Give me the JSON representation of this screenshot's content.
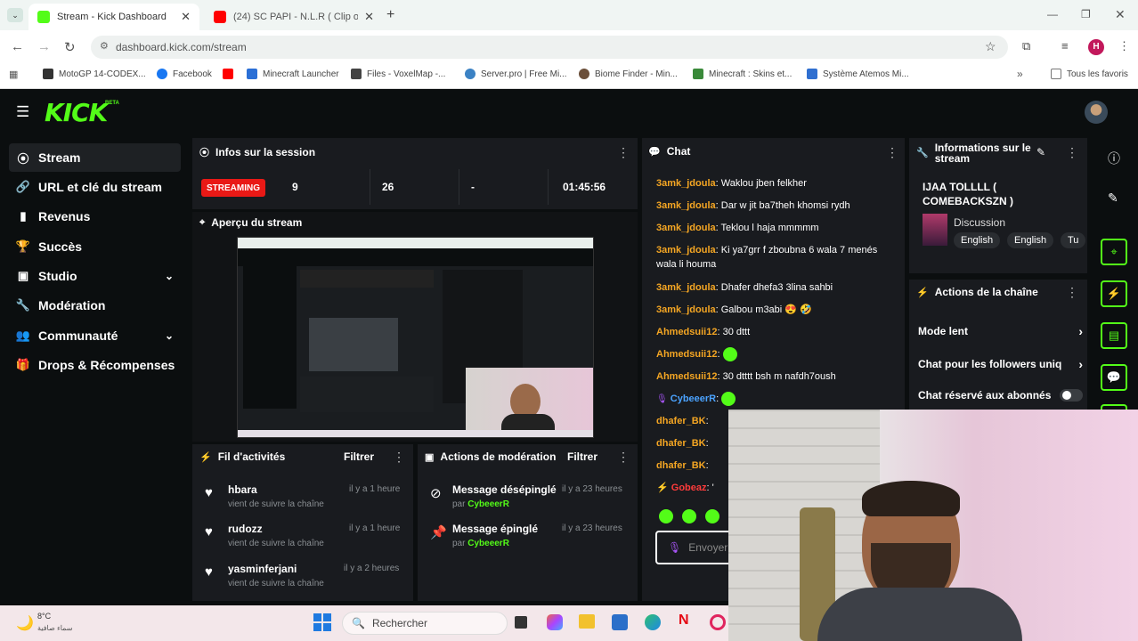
{
  "browser": {
    "tabs": [
      {
        "title": "Stream - Kick Dashboard",
        "active": true,
        "favicon_color": "#53fc18"
      },
      {
        "title": "(24) SC PAPI - N.L.R ( Clip offici",
        "active": false,
        "favicon_color": "#ff0000"
      }
    ],
    "url": "dashboard.kick.com/stream",
    "profile_initial": "H",
    "bookmarks": [
      "MotoGP 14-CODEX...",
      "Facebook",
      "",
      "Minecraft Launcher",
      "Files - VoxelMap -...",
      "Server.pro | Free Mi...",
      "Biome Finder - Min...",
      "Minecraft : Skins et...",
      "Système Atemos Mi..."
    ],
    "all_bookmarks": "Tous les favoris"
  },
  "kick": {
    "logo": "KICK",
    "beta": "BETA"
  },
  "sidebar": {
    "items": [
      {
        "label": "Stream",
        "icon": "broadcast-icon",
        "active": true
      },
      {
        "label": "URL et clé du stream",
        "icon": "link-icon"
      },
      {
        "label": "Revenus",
        "icon": "chart-icon"
      },
      {
        "label": "Succès",
        "icon": "trophy-icon"
      },
      {
        "label": "Studio",
        "icon": "studio-icon",
        "chevron": true
      },
      {
        "label": "Modération",
        "icon": "wrench-icon"
      },
      {
        "label": "Communauté",
        "icon": "people-icon",
        "chevron": true
      },
      {
        "label": "Drops & Récompenses",
        "icon": "gift-icon"
      }
    ]
  },
  "session": {
    "title": "Infos sur la session",
    "badge": "STREAMING",
    "viewers": "9",
    "followers": "26",
    "subs": "-",
    "uptime": "01:45:56"
  },
  "preview": {
    "title": "Aperçu du stream"
  },
  "activity": {
    "title": "Fil d'activités",
    "filter": "Filtrer",
    "items": [
      {
        "name": "hbara",
        "sub": "vient de suivre la chaîne",
        "time": "il y a 1 heure"
      },
      {
        "name": "rudozz",
        "sub": "vient de suivre la chaîne",
        "time": "il y a 1 heure"
      },
      {
        "name": "yasminferjani",
        "sub": "vient de suivre la chaîne",
        "time": "il y a 2 heures"
      }
    ]
  },
  "modactions": {
    "title": "Actions de modération",
    "filter": "Filtrer",
    "items": [
      {
        "name": "Message désépinglé",
        "by": "par",
        "user": "CybeeerR",
        "time": "il y a 23 heures"
      },
      {
        "name": "Message épinglé",
        "by": "par",
        "user": "CybeeerR",
        "time": "il y a 23 heures"
      }
    ]
  },
  "chat": {
    "title": "Chat",
    "messages": [
      {
        "user": "3amk_jdoula",
        "text": ": Waklou jben felkher"
      },
      {
        "user": "3amk_jdoula",
        "text": ": Dar w jit ba7theh khomsi rydh"
      },
      {
        "user": "3amk_jdoula",
        "text": ": Teklou l haja mmmmm"
      },
      {
        "user": "3amk_jdoula",
        "text": ": Ki ya7grr f zboubna 6 wala 7 menés wala li houma"
      },
      {
        "user": "3amk_jdoula",
        "text": ": Dhafer dhefa3 3lina sahbi"
      },
      {
        "user": "3amk_jdoula",
        "text": ": Galbou m3abi 😍 🤣"
      },
      {
        "user": "Ahmedsuii12",
        "text": ": 30 dttt"
      },
      {
        "user": "Ahmedsuii12",
        "text": ":"
      },
      {
        "user": "Ahmedsuii12",
        "text": ": 30 dtttt bsh m nafdh7oush"
      },
      {
        "user": "CybeeerR",
        "text": ":"
      },
      {
        "user": "dhafer_BK",
        "text": ":"
      },
      {
        "user": "dhafer_BK",
        "text": ":"
      },
      {
        "user": "dhafer_BK",
        "text": ":"
      },
      {
        "user": "Gobeaz",
        "text": ": '"
      }
    ],
    "input_placeholder": "Envoyer"
  },
  "streaminfo": {
    "title": "Informations sur le stream",
    "stream_title": "IJAA TOLLLL ( COMEBACKSZN )",
    "category": "Discussion",
    "tags": [
      "English",
      "English",
      "Tu"
    ]
  },
  "channelactions": {
    "title": "Actions de la chaîne",
    "rows": [
      "Mode lent",
      "Chat pour les followers uniq",
      "Chat réservé aux abonnés"
    ]
  },
  "taskbar": {
    "temp": "8°C",
    "weather": "سماء صافية",
    "search": "Rechercher"
  },
  "colors": {
    "accent": "#53fc18",
    "live": "#e91916",
    "bg": "#0b0e0f",
    "panel": "#191b1f"
  }
}
